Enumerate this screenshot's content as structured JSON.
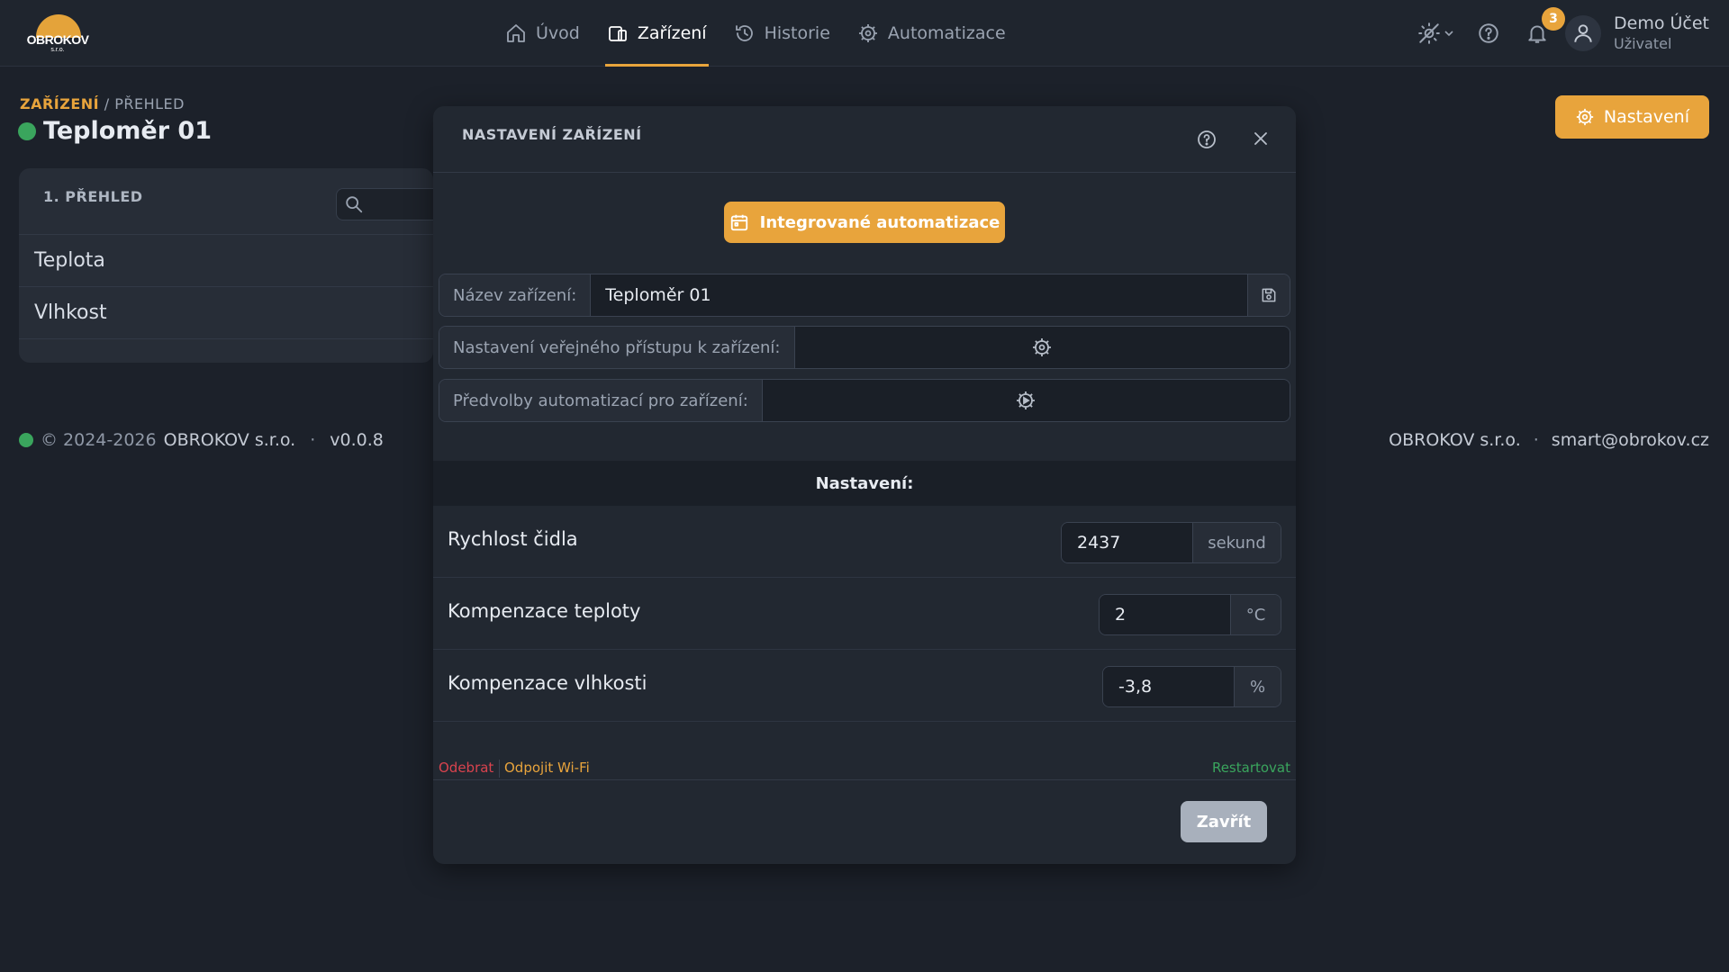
{
  "colors": {
    "accent": "#e8a43c",
    "success": "#3aa55d",
    "danger": "#d9434e",
    "bg": "#1c212a",
    "panel": "#272d37"
  },
  "logo": {
    "text": "OBROKOV",
    "sub": "s.r.o."
  },
  "nav": [
    {
      "label": "Úvod",
      "icon": "home-icon",
      "active": false
    },
    {
      "label": "Zařízení",
      "icon": "devices-icon",
      "active": true
    },
    {
      "label": "Historie",
      "icon": "history-icon",
      "active": false
    },
    {
      "label": "Automatizace",
      "icon": "gear-play-icon",
      "active": false
    }
  ],
  "notifications": {
    "count": "3"
  },
  "user": {
    "name": "Demo Účet",
    "role": "Uživatel"
  },
  "breadcrumb": {
    "parent": "ZAŘÍZENÍ",
    "separator": "/",
    "current": "PŘEHLED"
  },
  "page": {
    "title": "Teploměr 01",
    "settings_button": "Nastavení"
  },
  "panel": {
    "heading": "1. PŘEHLED",
    "rows": [
      "Teplota",
      "Vlhkost"
    ]
  },
  "footer": {
    "copyright": "© 2024-2026",
    "company": "OBROKOV s.r.o.",
    "dot": "·",
    "version": "v0.0.8",
    "right_company": "OBROKOV s.r.o.",
    "email": "smart@obrokov.cz"
  },
  "modal": {
    "title": "NASTAVENÍ ZAŘÍZENÍ",
    "automation_button": "Integrované automatizace",
    "name_label": "Název zařízení:",
    "name_value": "Teploměr 01",
    "public_access_label": "Nastavení veřejného přístupu k zařízení:",
    "presets_label": "Předvolby automatizací pro zařízení:",
    "section_title": "Nastavení:",
    "settings": [
      {
        "label": "Rychlost čidla",
        "value": "2437",
        "unit": "sekund"
      },
      {
        "label": "Kompenzace teploty",
        "value": "2",
        "unit": "°C"
      },
      {
        "label": "Kompenzace vlhkosti",
        "value": "-3,8",
        "unit": "%"
      }
    ],
    "remove_label": "Odebrat",
    "wifi_label": "Odpojit Wi-Fi",
    "restart_label": "Restartovat",
    "close_button": "Zavřít"
  }
}
